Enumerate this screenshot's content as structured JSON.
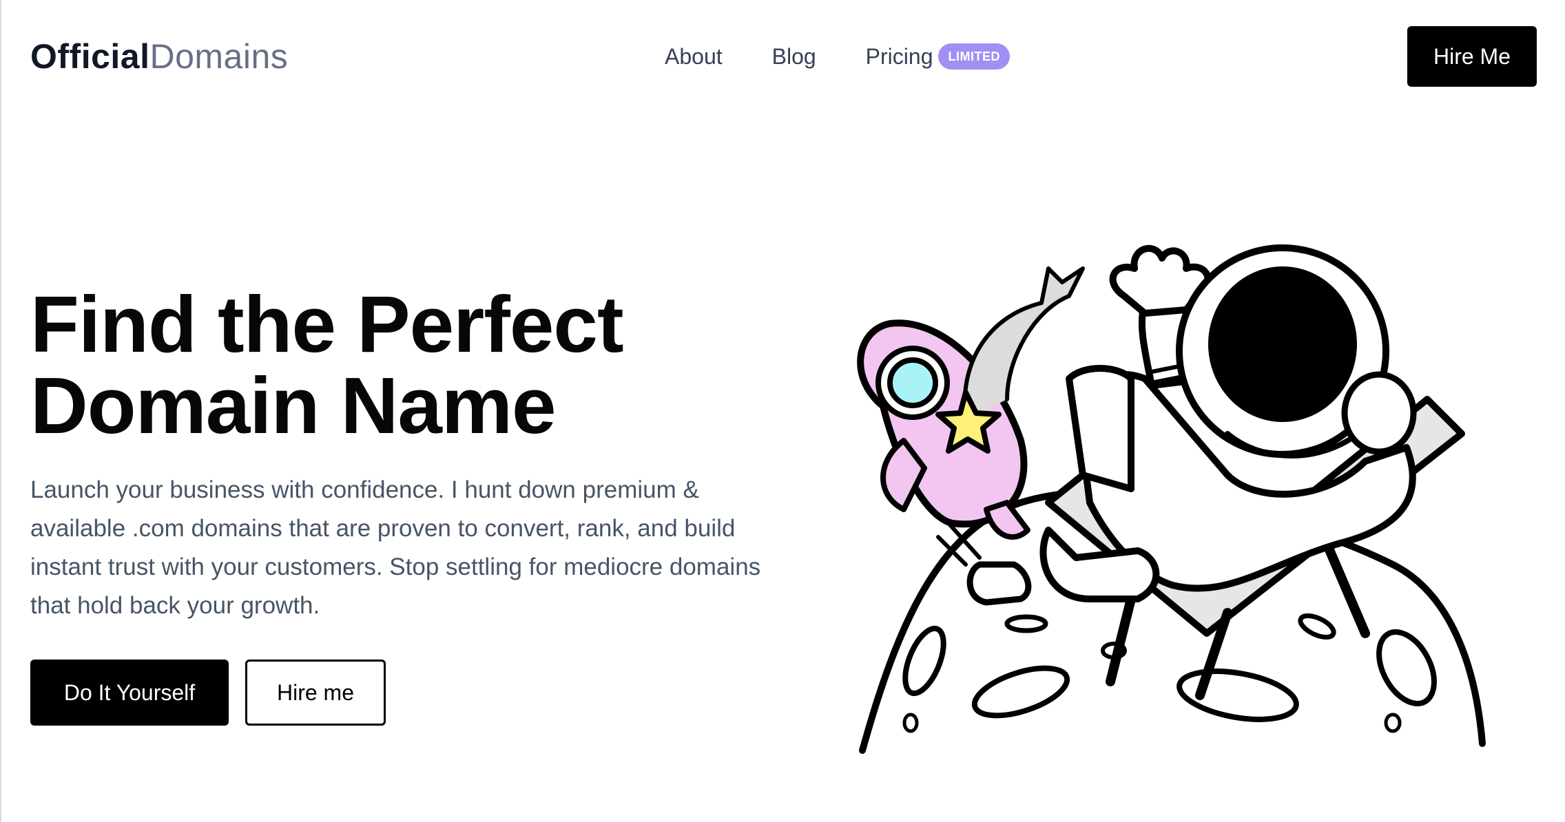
{
  "header": {
    "logo_bold": "Official",
    "logo_light": "Domains",
    "nav": {
      "about": "About",
      "blog": "Blog",
      "pricing": "Pricing",
      "pricing_badge": "LIMITED"
    },
    "cta": "Hire Me"
  },
  "hero": {
    "title_line1": "Find the Perfect",
    "title_line2": "Domain Name",
    "description": "Launch your business with confidence. I hunt down premium & available .com domains that are proven to convert, rank, and build instant trust with your customers. Stop settling for mediocre domains that hold back your growth.",
    "primary_button": "Do It Yourself",
    "secondary_button": "Hire me"
  },
  "illustration": {
    "icon": "astronaut-on-moon-illustration"
  },
  "colors": {
    "badge": "#a18ff2",
    "text_muted": "#475467",
    "black": "#000000",
    "rocket": "#f3c6f1",
    "window": "#a9f3f6",
    "star": "#fff07a"
  }
}
